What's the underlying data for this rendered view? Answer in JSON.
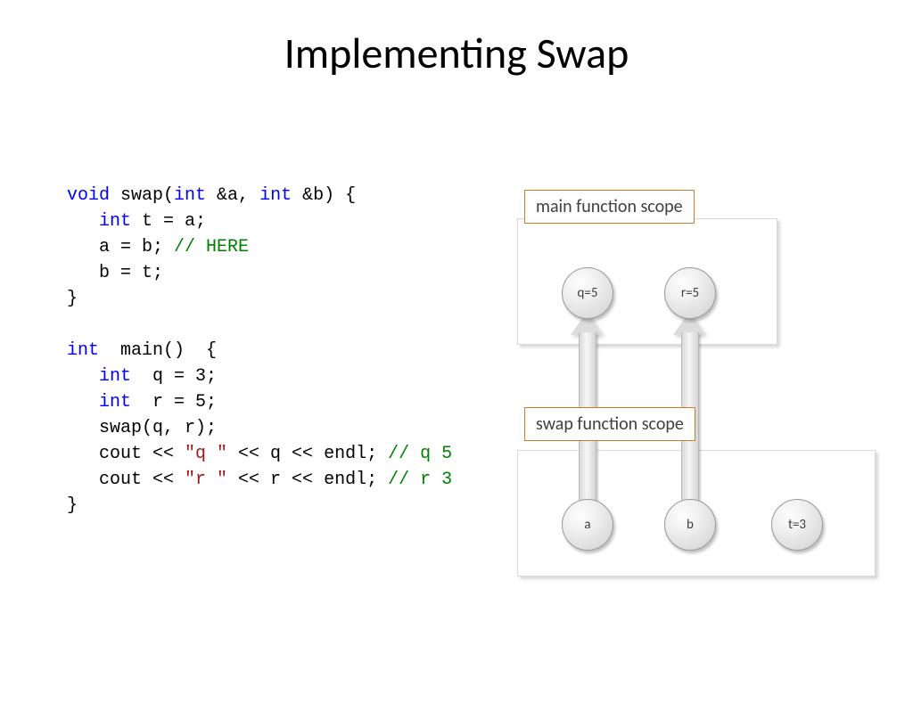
{
  "title": "Implementing Swap",
  "code": {
    "swap": {
      "kw_void": "void",
      "fn": " swap(",
      "kw_int1": "int",
      "amp_a": " &a, ",
      "kw_int2": "int",
      "amp_b": " &b) {",
      "l2_kw": "int",
      "l2_rest": " t = a;",
      "l3": "   a = b; ",
      "l3_comment": "// HERE",
      "l4": "   b = t;",
      "l5": "}"
    },
    "main": {
      "kw_int": "int",
      "sig": "  main()  {",
      "l2_kw": "int",
      "l2_rest": "  q = 3;",
      "l3_kw": "int",
      "l3_rest": "  r = 5;",
      "l4": "   swap(q, r);",
      "l5a": "   cout << ",
      "l5s": "\"q \"",
      "l5b": " << q << endl; ",
      "l5c": "// q 5",
      "l6a": "   cout << ",
      "l6s": "\"r \"",
      "l6b": " << r << endl; ",
      "l6c": "// r 3",
      "l7": "}"
    }
  },
  "diagram": {
    "main_scope_label": "main function scope",
    "swap_scope_label": "swap function scope",
    "nodes": {
      "q": "q=5",
      "r": "r=5",
      "a": "a",
      "b": "b",
      "t": "t=3"
    }
  }
}
